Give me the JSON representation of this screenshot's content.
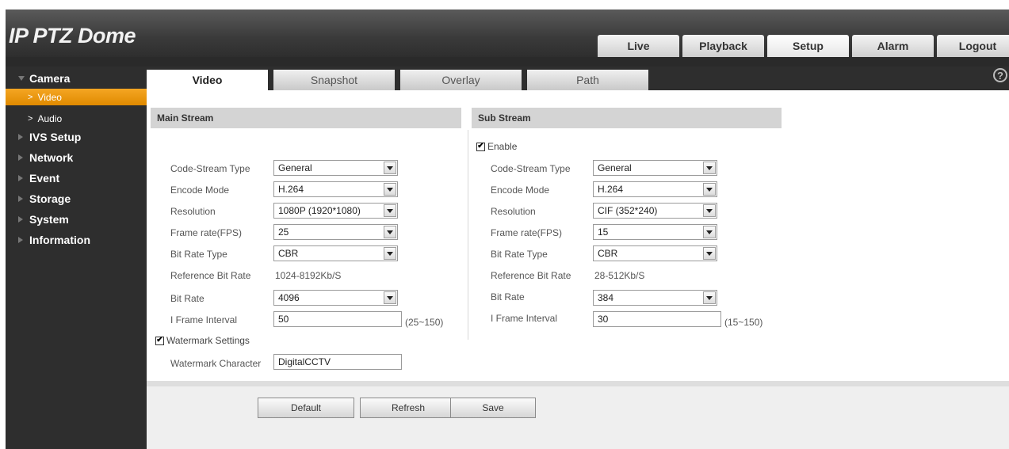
{
  "app": {
    "title": "IP PTZ Dome"
  },
  "nav": {
    "tabs": [
      "Live",
      "Playback",
      "Setup",
      "Alarm",
      "Logout"
    ],
    "active": "Setup"
  },
  "sidebar": {
    "camera": "Camera",
    "camera_items": [
      "Video",
      "Audio"
    ],
    "items": [
      "IVS Setup",
      "Network",
      "Event",
      "Storage",
      "System",
      "Information"
    ]
  },
  "subtabs": [
    "Video",
    "Snapshot",
    "Overlay",
    "Path"
  ],
  "help_icon": "?",
  "main": {
    "title": "Main Stream",
    "fields": {
      "code_stream_type": {
        "label": "Code-Stream Type",
        "value": "General"
      },
      "encode_mode": {
        "label": "Encode Mode",
        "value": "H.264"
      },
      "resolution": {
        "label": "Resolution",
        "value": "1080P (1920*1080)"
      },
      "frame_rate": {
        "label": "Frame rate(FPS)",
        "value": "25"
      },
      "bit_rate_type": {
        "label": "Bit Rate Type",
        "value": "CBR"
      },
      "reference_bit_rate": {
        "label": "Reference Bit Rate",
        "value": "1024-8192Kb/S"
      },
      "bit_rate": {
        "label": "Bit Rate",
        "value": "4096"
      },
      "i_frame_interval": {
        "label": "I Frame Interval",
        "value": "50",
        "range": "(25~150)"
      }
    },
    "watermark": {
      "label": "Watermark Settings",
      "checked": true,
      "char_label": "Watermark Character",
      "char_value": "DigitalCCTV"
    }
  },
  "sub": {
    "title": "Sub Stream",
    "enable": {
      "label": "Enable",
      "checked": true
    },
    "fields": {
      "code_stream_type": {
        "label": "Code-Stream Type",
        "value": "General"
      },
      "encode_mode": {
        "label": "Encode Mode",
        "value": "H.264"
      },
      "resolution": {
        "label": "Resolution",
        "value": "CIF (352*240)"
      },
      "frame_rate": {
        "label": "Frame rate(FPS)",
        "value": "15"
      },
      "bit_rate_type": {
        "label": "Bit Rate Type",
        "value": "CBR"
      },
      "reference_bit_rate": {
        "label": "Reference Bit Rate",
        "value": "28-512Kb/S"
      },
      "bit_rate": {
        "label": "Bit Rate",
        "value": "384"
      },
      "i_frame_interval": {
        "label": "I Frame Interval",
        "value": "30",
        "range": "(15~150)"
      }
    }
  },
  "buttons": {
    "default": "Default",
    "refresh": "Refresh",
    "save": "Save"
  },
  "colors": {
    "header": "#3a3a3a",
    "sidebar": "#2e2e2e",
    "active_item": "#f5a623",
    "section_bg": "#d4d4d4"
  }
}
